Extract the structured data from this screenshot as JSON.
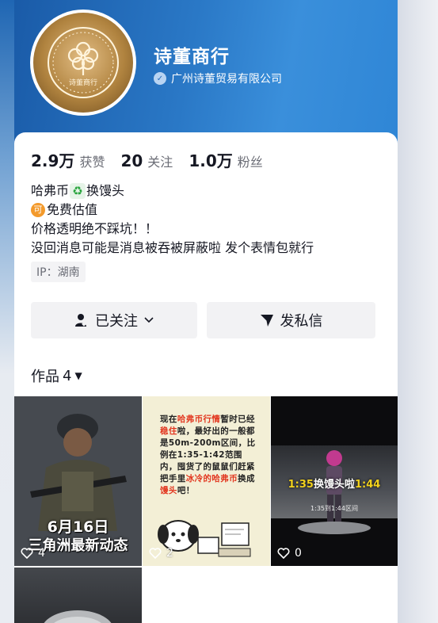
{
  "profile": {
    "name": "诗董商行",
    "verified_company": "广州诗董贸易有限公司",
    "avatar_text": "诗董商行"
  },
  "stats": {
    "likes_num": "2.9万",
    "likes_label": "获赞",
    "following_num": "20",
    "following_label": "关注",
    "fans_num": "1.0万",
    "fans_label": "粉丝"
  },
  "bio": {
    "line1_a": "哈弗币",
    "line1_b": "换馒头",
    "line2_badge": "可",
    "line2": "免费估值",
    "line3": "价格透明绝不踩坑！！",
    "line4": "没回消息可能是消息被吞被屏蔽啦 发个表情包就行"
  },
  "ip": "IP：湖南",
  "actions": {
    "follow": "已关注",
    "message": "发私信"
  },
  "works": {
    "label": "作品",
    "count": "4"
  },
  "tiles": [
    {
      "date": "6月16日",
      "caption": "三角洲最新动态",
      "likes": "4"
    },
    {
      "text_parts": [
        "现在",
        "哈弗币行情",
        "暂时已经",
        "稳住",
        "啦，最好出的一般都是50m-200m区间，比例在1:35-1:42范围内，囤货了的鼠鼠们赶紧把手里",
        "冰冷的哈弗币",
        "换成",
        "馒头",
        "吧！"
      ],
      "likes": "2"
    },
    {
      "title_a": "1:35",
      "title_b": "换馒头啦",
      "title_c": "1:44",
      "sub": "1:35到1:44区间",
      "likes": "0"
    }
  ],
  "colors": {
    "header_blue": "#2a78c6",
    "verify_blue": "#b9d4f2",
    "badge_orange": "#f39a2c",
    "recycle_green": "#27a43c",
    "highlight_red": "#e2361f"
  }
}
